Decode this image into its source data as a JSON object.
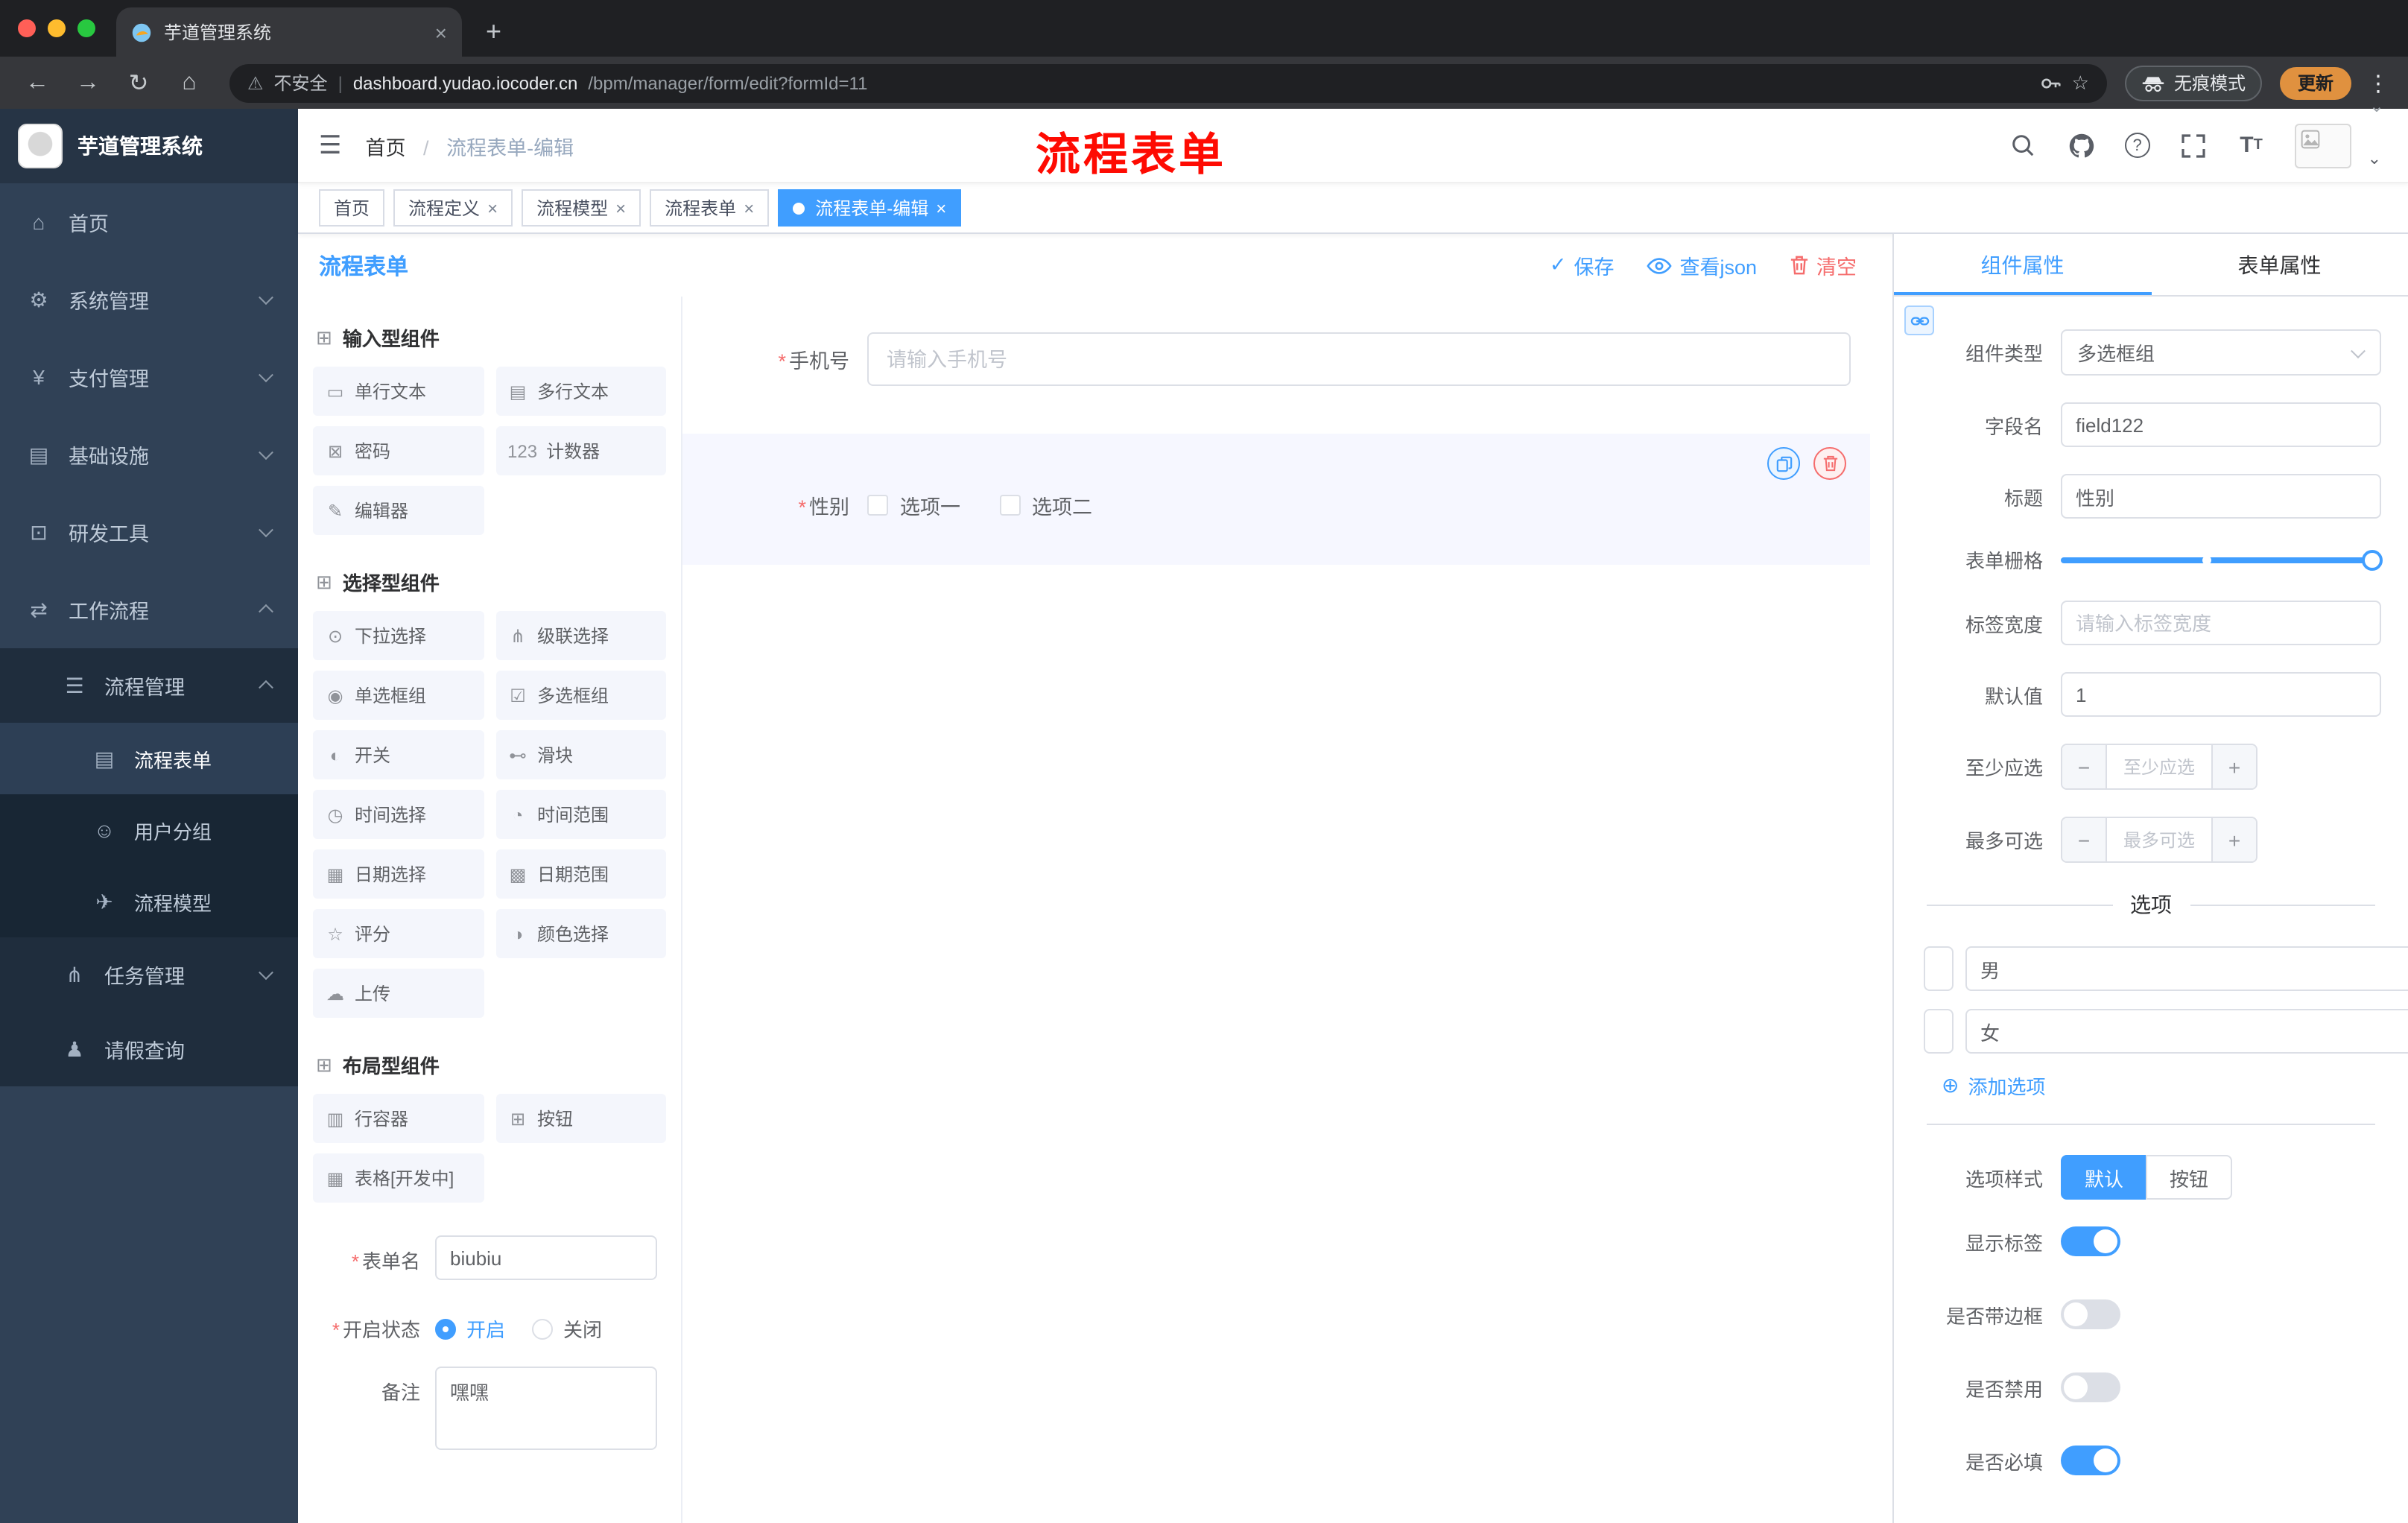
{
  "icons": {
    "back": "←",
    "forward": "→",
    "reload": "↻",
    "home": "⌂",
    "new_tab": "+",
    "close": "×",
    "menu_dots": "⋮",
    "star": "☆",
    "warning": "⚠",
    "caret": "⌄",
    "hamburger": "☰",
    "question": "?",
    "check": "✓",
    "add": "⊕",
    "minus": "−",
    "plus": "+",
    "required": "*",
    "divider": "|",
    "font_size_big": "T",
    "font_size_small": "T"
  },
  "browser": {
    "tab": {
      "title": "芋道管理系统"
    },
    "address": {
      "security": "不安全",
      "host": "dashboard.yudao.iocoder.cn",
      "path": "/bpm/manager/form/edit?formId=11"
    },
    "incognito": "无痕模式",
    "update": "更新"
  },
  "sidebar": {
    "app_title": "芋道管理系统",
    "items": [
      {
        "icon": "⌂",
        "label": "首页"
      },
      {
        "icon": "⚙",
        "label": "系统管理"
      },
      {
        "icon": "¥",
        "label": "支付管理"
      },
      {
        "icon": "▤",
        "label": "基础设施"
      },
      {
        "icon": "⊡",
        "label": "研发工具"
      },
      {
        "icon": "⇄",
        "label": "工作流程"
      },
      {
        "icon": "☰",
        "label": "流程管理"
      },
      {
        "icon": "▤",
        "label": "流程表单"
      },
      {
        "icon": "☺",
        "label": "用户分组"
      },
      {
        "icon": "✈",
        "label": "流程模型"
      },
      {
        "icon": "⋔",
        "label": "任务管理"
      },
      {
        "icon": "♟",
        "label": "请假查询"
      }
    ]
  },
  "header": {
    "breadcrumb_home": "首页",
    "separator": "/",
    "breadcrumb_current": "流程表单-编辑",
    "annotation": "流程表单"
  },
  "tags": {
    "items": [
      {
        "label": "首页"
      },
      {
        "label": "流程定义"
      },
      {
        "label": "流程模型"
      },
      {
        "label": "流程表单"
      },
      {
        "label": "流程表单-编辑"
      }
    ]
  },
  "designer": {
    "title": "流程表单",
    "save": "保存",
    "view_json": "查看json",
    "clear": "清空",
    "groups": [
      {
        "icon": "⊞",
        "title": "输入型组件",
        "items": [
          {
            "icon": "▭",
            "label": "单行文本"
          },
          {
            "icon": "▤",
            "label": "多行文本"
          },
          {
            "icon": "⊠",
            "label": "密码"
          },
          {
            "icon": "123",
            "label": "计数器"
          },
          {
            "icon": "✎",
            "label": "编辑器"
          }
        ]
      },
      {
        "icon": "⊞",
        "title": "选择型组件",
        "items": [
          {
            "icon": "⊙",
            "label": "下拉选择"
          },
          {
            "icon": "⋔",
            "label": "级联选择"
          },
          {
            "icon": "◉",
            "label": "单选框组"
          },
          {
            "icon": "☑",
            "label": "多选框组"
          },
          {
            "icon": "◐",
            "label": "开关"
          },
          {
            "icon": "⊷",
            "label": "滑块"
          },
          {
            "icon": "◷",
            "label": "时间选择"
          },
          {
            "icon": "◔",
            "label": "时间范围"
          },
          {
            "icon": "▦",
            "label": "日期选择"
          },
          {
            "icon": "▩",
            "label": "日期范围"
          },
          {
            "icon": "☆",
            "label": "评分"
          },
          {
            "icon": "◑",
            "label": "颜色选择"
          },
          {
            "icon": "☁",
            "label": "上传"
          }
        ]
      },
      {
        "icon": "⊞",
        "title": "布局型组件",
        "items": [
          {
            "icon": "▥",
            "label": "行容器"
          },
          {
            "icon": "⊞",
            "label": "按钮"
          },
          {
            "icon": "▦",
            "label": "表格[开发中]"
          }
        ]
      }
    ],
    "meta": {
      "name_label": "表单名",
      "name_value": "biubiu",
      "status_label": "开启状态",
      "status_on": "开启",
      "status_off": "关闭",
      "remark_label": "备注",
      "remark_value": "嘿嘿"
    }
  },
  "canvas": {
    "phone": {
      "label": "手机号",
      "placeholder": "请输入手机号"
    },
    "gender": {
      "label": "性别",
      "options": [
        {
          "label": "选项一"
        },
        {
          "label": "选项二"
        }
      ]
    }
  },
  "props": {
    "tab_component": "组件属性",
    "tab_form": "表单属性",
    "component_type": {
      "label": "组件类型",
      "value": "多选框组"
    },
    "field_name": {
      "label": "字段名",
      "value": "field122"
    },
    "title": {
      "label": "标题",
      "value": "性别"
    },
    "grid": {
      "label": "表单栅格"
    },
    "label_width": {
      "label": "标签宽度",
      "placeholder": "请输入标签宽度"
    },
    "default_value": {
      "label": "默认值",
      "value": "1"
    },
    "min_select": {
      "label": "至少应选",
      "placeholder": "至少应选"
    },
    "max_select": {
      "label": "最多可选",
      "placeholder": "最多可选"
    },
    "options_title": "选项",
    "options": [
      {
        "label": "选项一",
        "value": "男"
      },
      {
        "label": "选项二",
        "value": "女"
      }
    ],
    "add_option": "添加选项",
    "option_style": {
      "label": "选项样式",
      "default": "默认",
      "button": "按钮"
    },
    "show_label": {
      "label": "显示标签"
    },
    "border": {
      "label": "是否带边框"
    },
    "disabled": {
      "label": "是否禁用"
    },
    "required": {
      "label": "是否必填"
    }
  }
}
